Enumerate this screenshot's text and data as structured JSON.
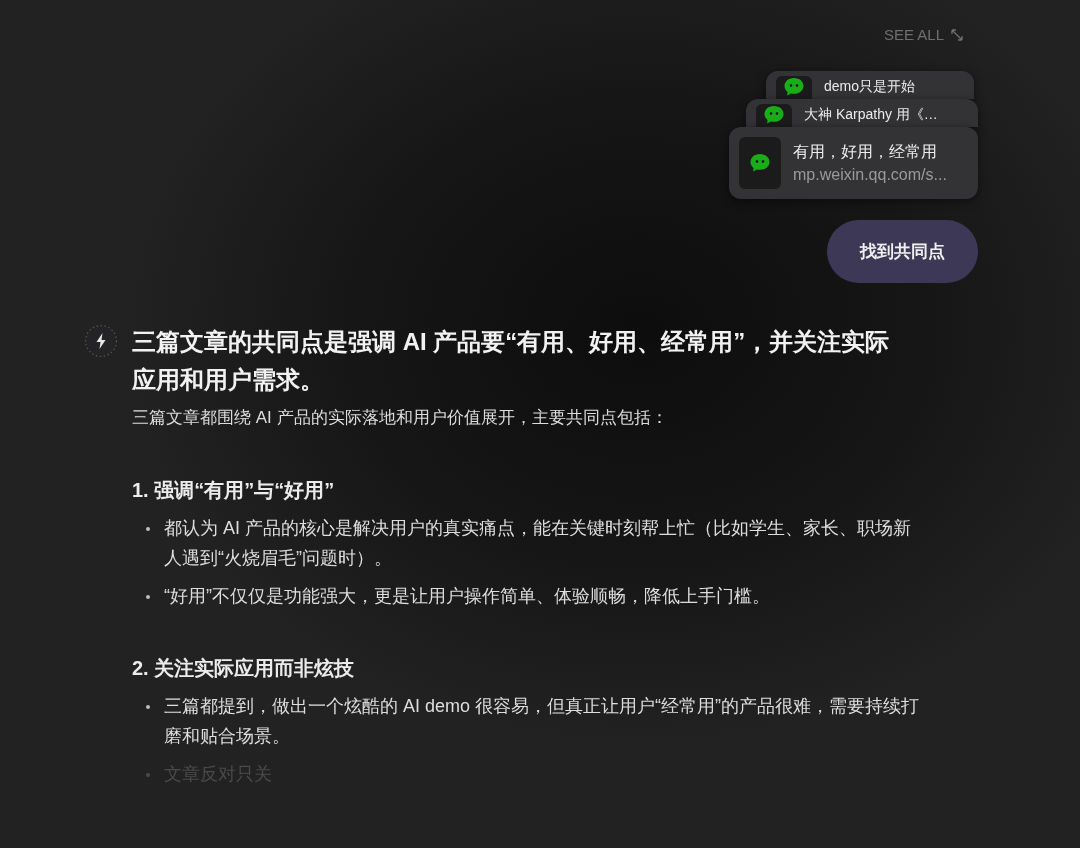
{
  "header": {
    "see_all": "SEE ALL"
  },
  "attachments": [
    {
      "title": "demo只是开始"
    },
    {
      "title": "大神 Karpathy 用《…"
    },
    {
      "title": "有用，好用，经常用",
      "url": "mp.weixin.qq.com/s..."
    }
  ],
  "user_message": "找到共同点",
  "answer": {
    "headline": "三篇文章的共同点是强调 AI 产品要“有用、好用、经常用”，并关注实际应用和用户需求。",
    "intro": "三篇文章都围绕 AI 产品的实际落地和用户价值展开，主要共同点包括：",
    "sections": [
      {
        "heading": "1. 强调“有用”与“好用”",
        "bullets": [
          {
            "text": "都认为 AI 产品的核心是解决用户的真实痛点，能在关键时刻帮上忙（比如学生、家长、职场新人遇到“火烧眉毛”问题时）。",
            "faded": false
          },
          {
            "text": "“好用”不仅仅是功能强大，更是让用户操作简单、体验顺畅，降低上手门槛。",
            "faded": false
          }
        ]
      },
      {
        "heading": "2. 关注实际应用而非炫技",
        "bullets": [
          {
            "text": "三篇都提到，做出一个炫酷的 AI demo 很容易，但真正让用户“经常用”的产品很难，需要持续打磨和贴合场景。",
            "faded": false
          },
          {
            "text": "文章反对只关",
            "faded": true
          }
        ]
      }
    ]
  }
}
